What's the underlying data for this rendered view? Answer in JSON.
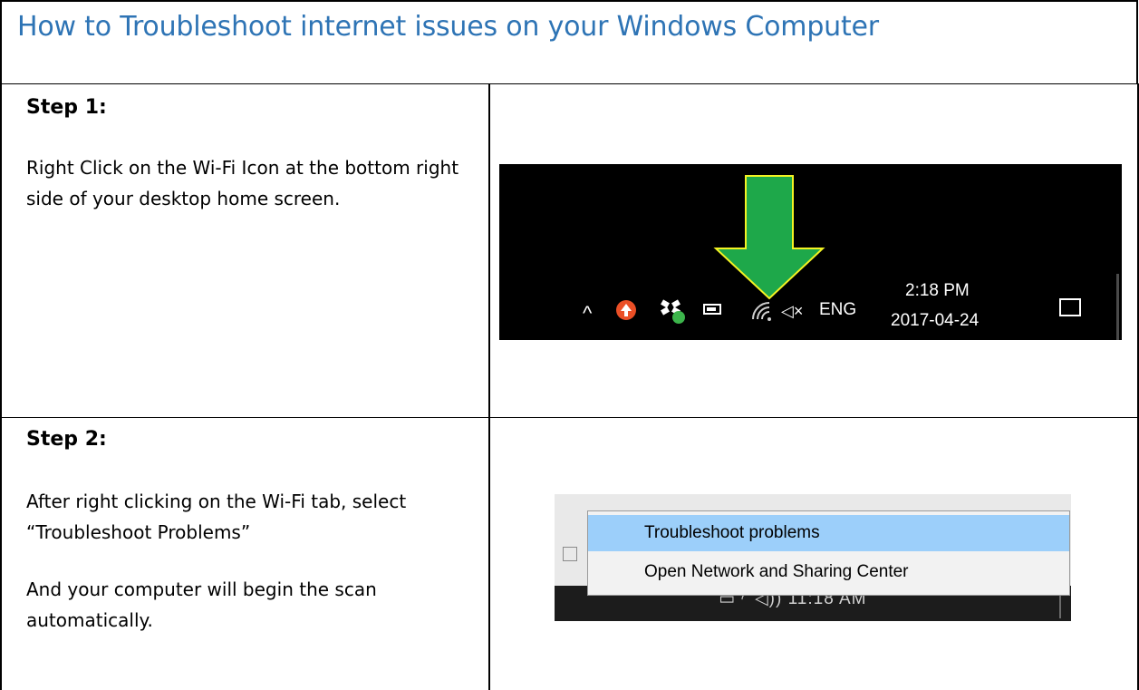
{
  "title": "How to Troubleshoot internet issues on your Windows Computer",
  "steps": [
    {
      "heading": "Step 1:",
      "paragraphs": [
        "Right Click on the Wi-Fi Icon at the bottom right side of your desktop home screen."
      ],
      "screenshot": {
        "tray_caret": "^",
        "language": "ENG",
        "time": "2:18 PM",
        "date": "2017-04-24",
        "mute_symbol": "×",
        "icons": [
          "up-arrow-icon",
          "dropbox-icon",
          "battery-icon",
          "wifi-icon",
          "speaker-muted-icon",
          "notification-icon"
        ],
        "arrow_color": "#1ea84a",
        "arrow_outline_color": "#f3f323"
      }
    },
    {
      "heading": "Step 2:",
      "paragraphs": [
        "After right clicking on the Wi-Fi tab, select “Troubleshoot Problems”",
        "And your computer will begin the scan automatically."
      ],
      "screenshot": {
        "menu_items": [
          "Troubleshoot problems",
          "Open Network and Sharing Center"
        ],
        "taskbar_time": "11:18 AM",
        "highlight_color": "#9ccffa"
      }
    }
  ],
  "colors": {
    "title": "#2e74b5",
    "border": "#000000"
  }
}
